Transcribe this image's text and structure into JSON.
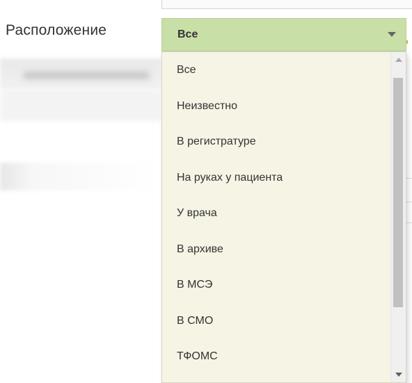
{
  "field": {
    "label": "Расположение",
    "selected_value": "Все"
  },
  "dropdown": {
    "options": [
      "Все",
      "Неизвестно",
      "В регистратуре",
      "На руках у пациента",
      "У врача",
      "В архиве",
      "В МСЭ",
      "В СМО",
      "ТФОМС"
    ]
  },
  "colors": {
    "select_background": "#c9dfa8",
    "dropdown_background": "#f6f4e4",
    "text": "#333333"
  },
  "icons": {
    "select_arrow": "chevron-down-icon",
    "scroll_up": "scroll-up-arrow-icon",
    "scroll_down": "scroll-down-arrow-icon"
  }
}
